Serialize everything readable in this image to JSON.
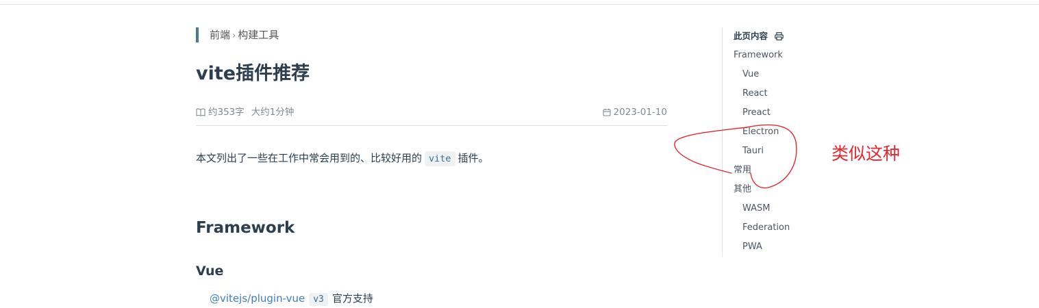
{
  "breadcrumb": {
    "parent": "前端",
    "separator": "›",
    "current": "构建工具"
  },
  "title": "vite插件推荐",
  "meta": {
    "word_count": "约353字",
    "read_time": "大约1分钟",
    "date": "2023-01-10"
  },
  "intro": {
    "before": "本文列出了一些在工作中常会用到的、比较好用的",
    "code": "vite",
    "after": "插件。"
  },
  "sections": {
    "h2": "Framework",
    "h3": "Vue",
    "cut_link": "@vitejs/plugin-vue",
    "cut_code": "v3",
    "cut_text": "官方支持"
  },
  "toc": {
    "header": "此页内容",
    "items": [
      {
        "label": "Framework"
      },
      {
        "label": "Vue"
      },
      {
        "label": "React"
      },
      {
        "label": "Preact"
      },
      {
        "label": "Electron"
      },
      {
        "label": "Tauri"
      },
      {
        "label": "常用"
      },
      {
        "label": "其他"
      },
      {
        "label": "WASM"
      },
      {
        "label": "Federation"
      },
      {
        "label": "PWA"
      }
    ]
  },
  "annotation": {
    "text": "类似这种",
    "color": "#e8262d"
  },
  "colors": {
    "accent": "#4a7c8c",
    "link": "#3e7fb8",
    "text": "#2c3e50"
  }
}
